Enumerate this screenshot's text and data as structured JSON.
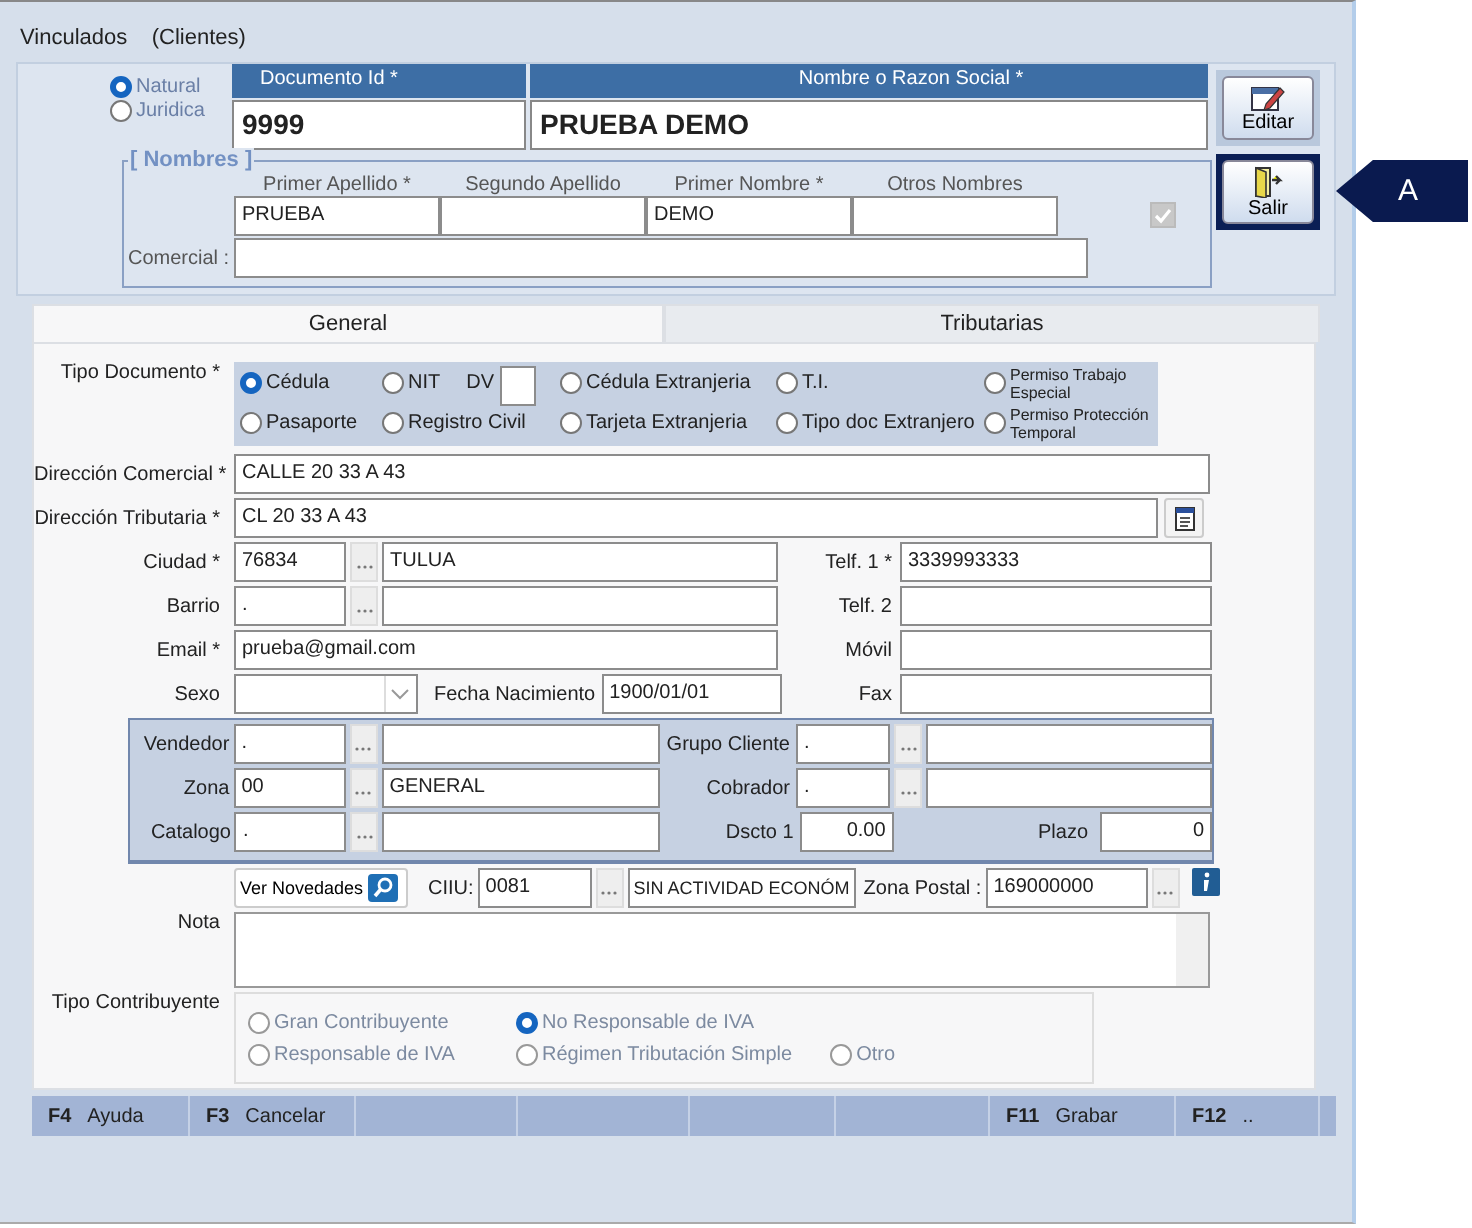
{
  "window": {
    "title": "Vinculados    (Clientes)"
  },
  "person_type": [
    {
      "label": "Natural",
      "selected": true
    },
    {
      "label": "Juridica",
      "selected": false
    }
  ],
  "header_fields": [
    {
      "label": "Documento Id *",
      "value": "9999"
    },
    {
      "label": "Nombre  o  Razon Social *",
      "value": "PRUEBA DEMO"
    }
  ],
  "nombres": {
    "title": "[ Nombres ]",
    "fields": [
      {
        "label": "Primer Apellido *",
        "value": "PRUEBA"
      },
      {
        "label": "Segundo Apellido"
      },
      {
        "label": "Primer Nombre *",
        "value": "DEMO"
      },
      {
        "label": "Otros Nombres"
      }
    ],
    "checkbox": {
      "checked": true,
      "disabled": true
    },
    "comercial_label": "Comercial :"
  },
  "actions": [
    {
      "kind": "edit",
      "label": "Editar",
      "highlighted": false
    },
    {
      "kind": "exit",
      "label": "Salir",
      "highlighted": true
    }
  ],
  "callout": {
    "label": "A"
  },
  "tabs": [
    {
      "label": "General",
      "selected": true
    },
    {
      "label": "Tributarias",
      "selected": false
    }
  ],
  "tipo_documento": {
    "label": "Tipo Documento *",
    "dv_label": "DV",
    "options": [
      {
        "label": "Cédula",
        "selected": true,
        "small": false
      },
      {
        "label": "NIT",
        "selected": false,
        "small": false
      },
      {
        "label": "Cédula Extranjeria",
        "selected": false,
        "small": false
      },
      {
        "label": "T.I.",
        "selected": false,
        "small": false
      },
      {
        "label": "Permiso Trabajo Especial",
        "selected": false,
        "small": true
      },
      {
        "label": "Pasaporte",
        "selected": false,
        "small": false
      },
      {
        "label": "Registro Civil",
        "selected": false,
        "small": false
      },
      {
        "label": "Tarjeta Extranjeria",
        "selected": false,
        "small": false
      },
      {
        "label": "Tipo doc Extranjero",
        "selected": false,
        "small": false
      },
      {
        "label": "Permiso Protección Temporal",
        "selected": false,
        "small": true
      }
    ]
  },
  "addresses": [
    {
      "label": "Dirección Comercial *",
      "value": "CALLE 20 33 A 43",
      "has_button": false
    },
    {
      "label": "Dirección Tributaria *",
      "value": "CL 20 33 A 43",
      "has_button": true
    }
  ],
  "rows": [
    {
      "left": {
        "kind": "lookup",
        "label": "Ciudad *",
        "code": "76834",
        "name": "TULUA"
      },
      "right": {
        "label": "Telf. 1 *",
        "value": "3339993333"
      }
    },
    {
      "left": {
        "kind": "lookup",
        "label": "Barrio",
        "code": "."
      },
      "right": {
        "label": "Telf. 2"
      }
    },
    {
      "left": {
        "kind": "text",
        "label": "Email *",
        "value": "prueba@gmail.com"
      },
      "right": {
        "label": "Móvil"
      }
    },
    {
      "left": {
        "kind": "sexo",
        "label": "Sexo",
        "date_label": "Fecha Nacimiento",
        "date": "1900/01/01"
      },
      "right": {
        "label": "Fax"
      }
    }
  ],
  "assignments": [
    {
      "left": {
        "label": "Vendedor",
        "code": "."
      },
      "right": {
        "kind": "lookup",
        "label": "Grupo Cliente",
        "code": "."
      }
    },
    {
      "left": {
        "label": "Zona",
        "code": "00",
        "name": "GENERAL"
      },
      "right": {
        "kind": "lookup",
        "label": "Cobrador",
        "code": "."
      }
    },
    {
      "left": {
        "label": "Catalogo",
        "code": "."
      },
      "right": {
        "kind": "discount",
        "label": "Dscto 1",
        "value": "0.00",
        "plazo_label": "Plazo",
        "plazo": "0"
      }
    }
  ],
  "ciiu_row": {
    "button": "Ver Novedades",
    "ciiu_label": "CIIU:",
    "ciiu_code": "0081",
    "ciiu_name": "SIN ACTIVIDAD ECONÓM",
    "postal_label": "Zona Postal :",
    "postal": "169000000"
  },
  "nota": {
    "label": "Nota"
  },
  "tipo_contribuyente": {
    "label": "Tipo Contribuyente",
    "disabled": true,
    "columns": [
      [
        {
          "label": "Gran Contribuyente",
          "selected": false
        },
        {
          "label": "Responsable de IVA",
          "selected": false
        }
      ],
      [
        {
          "label": "No Responsable de IVA",
          "selected": true
        },
        {
          "label": "Régimen Tributación Simple",
          "selected": false
        }
      ],
      [
        {
          "label": "Otro",
          "selected": false
        }
      ]
    ]
  },
  "status_bar": [
    {
      "kind": "key",
      "key": "F4",
      "label": "Ayuda"
    },
    {
      "kind": "key",
      "key": "F3",
      "label": "Cancelar"
    },
    {
      "kind": "blank"
    },
    {
      "kind": "blank"
    },
    {
      "kind": "blank"
    },
    {
      "kind": "blank"
    },
    {
      "kind": "key",
      "key": "F11",
      "label": "Grabar"
    },
    {
      "kind": "key",
      "key": "F12",
      "label": ".."
    }
  ]
}
